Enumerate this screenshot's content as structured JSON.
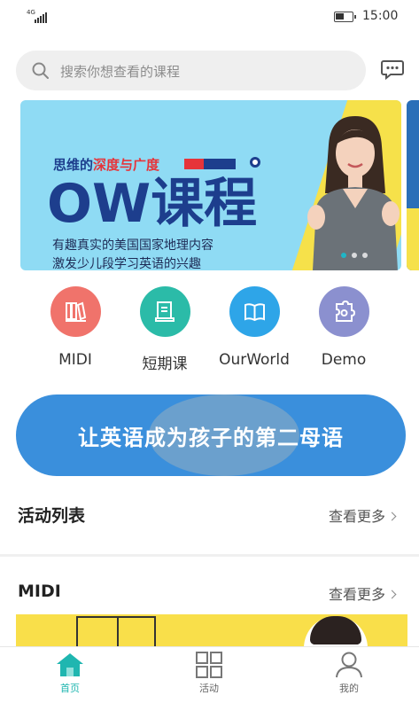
{
  "status_bar": {
    "network": "4G",
    "battery_fraction": 0.55,
    "time": "15:00"
  },
  "search": {
    "placeholder": "搜索你想查看的课程",
    "icon": "search-icon",
    "message_icon": "message-icon"
  },
  "banner": {
    "tagline_a": "思维的",
    "tagline_b": "深度与广度",
    "title": "OW课程",
    "line1": "有趣真实的美国国家地理内容",
    "line2": "激发少儿段学习英语的兴趣",
    "slide_count": 3,
    "active_slide": 0
  },
  "categories": [
    {
      "label": "MIDI",
      "color": "#f0736b",
      "icon": "books-icon"
    },
    {
      "label": "短期课",
      "color": "#2bbba8",
      "icon": "document-icon"
    },
    {
      "label": "OurWorld",
      "color": "#2ea5e8",
      "icon": "open-book-icon"
    },
    {
      "label": "Demo",
      "color": "#8b90cf",
      "icon": "puzzle-icon"
    }
  ],
  "slogan": "让英语成为孩子的第二母语",
  "sections": {
    "activities": {
      "title": "活动列表",
      "more": "查看更多"
    },
    "midi": {
      "title": "MIDI",
      "more": "查看更多"
    }
  },
  "tabbar": {
    "items": [
      {
        "label": "首页",
        "icon": "home-icon",
        "active": true
      },
      {
        "label": "活动",
        "icon": "grid-icon",
        "active": false
      },
      {
        "label": "我的",
        "icon": "user-icon",
        "active": false
      }
    ],
    "active_color": "#1fb6b0"
  }
}
